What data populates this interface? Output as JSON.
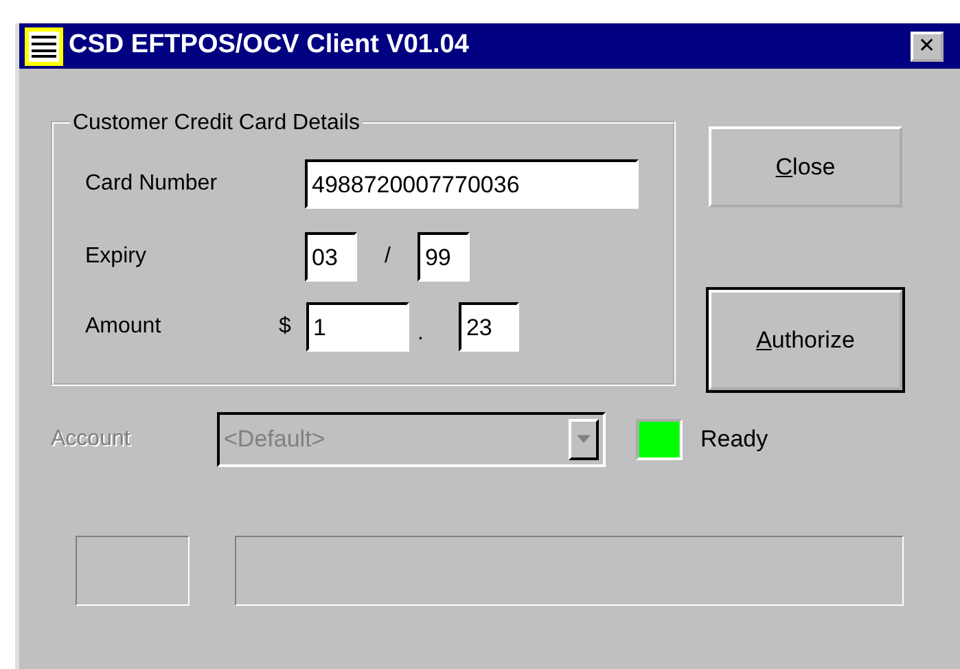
{
  "window": {
    "title": "CSD EFTPOS/OCV Client V01.04",
    "close_glyph": "✕"
  },
  "card_details": {
    "legend": "Customer Credit Card Details",
    "card_number": {
      "label": "Card Number",
      "value": "4988720007770036"
    },
    "expiry": {
      "label": "Expiry",
      "month": "03",
      "separator": "/",
      "year": "99"
    },
    "amount": {
      "label": "Amount",
      "currency": "$",
      "dollars": "1",
      "separator": ".",
      "cents": "23"
    }
  },
  "buttons": [
    {
      "label": "Close",
      "access_key_underlined": true,
      "default": false
    },
    {
      "label": "Authorize",
      "access_key_underlined": true,
      "default": true
    }
  ],
  "account": {
    "label": "Account",
    "value": "<Default>",
    "disabled": true
  },
  "status": {
    "color": "#00ff00",
    "text": "Ready"
  }
}
